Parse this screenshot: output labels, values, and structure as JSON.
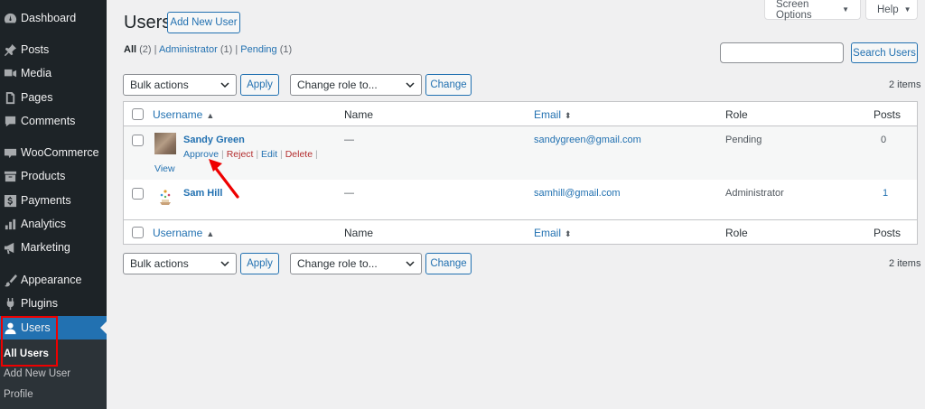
{
  "sidebar": {
    "items": [
      {
        "label": "Dashboard",
        "icon": "dashboard-icon"
      },
      {
        "label": "Posts",
        "icon": "pin-icon"
      },
      {
        "label": "Media",
        "icon": "media-icon"
      },
      {
        "label": "Pages",
        "icon": "pages-icon"
      },
      {
        "label": "Comments",
        "icon": "comment-icon"
      },
      {
        "label": "WooCommerce",
        "icon": "woo-icon"
      },
      {
        "label": "Products",
        "icon": "archive-icon"
      },
      {
        "label": "Payments",
        "icon": "dollar-icon"
      },
      {
        "label": "Analytics",
        "icon": "chart-icon"
      },
      {
        "label": "Marketing",
        "icon": "megaphone-icon"
      },
      {
        "label": "Appearance",
        "icon": "brush-icon"
      },
      {
        "label": "Plugins",
        "icon": "plug-icon"
      },
      {
        "label": "Users",
        "icon": "user-icon"
      }
    ],
    "submenu": [
      "All Users",
      "Add New User",
      "Profile"
    ]
  },
  "header": {
    "title": "Users",
    "add_new": "Add New User",
    "screen_options": "Screen Options",
    "help": "Help"
  },
  "filters": {
    "all": "All",
    "all_count": "(2)",
    "administrator": "Administrator",
    "administrator_count": "(1)",
    "pending": "Pending",
    "pending_count": "(1)",
    "sep": "|"
  },
  "search": {
    "button": "Search Users",
    "value": ""
  },
  "bulk": {
    "actions": "Bulk actions",
    "apply": "Apply",
    "role": "Change role to...",
    "change": "Change",
    "items": "2 items"
  },
  "table": {
    "columns": [
      "Username",
      "Name",
      "Email",
      "Role",
      "Posts"
    ],
    "rows": [
      {
        "username": "Sandy Green",
        "name": "—",
        "email": "sandygreen@gmail.com",
        "role": "Pending",
        "posts": "0",
        "actions": {
          "approve": "Approve",
          "reject": "Reject",
          "edit": "Edit",
          "delete": "Delete",
          "view": "View",
          "sep": "|"
        }
      },
      {
        "username": "Sam Hill",
        "name": "—",
        "email": "samhill@gmail.com",
        "role": "Administrator",
        "posts": "1"
      }
    ]
  },
  "colors": {
    "accent": "#2271b1",
    "sidebar": "#1d2327",
    "highlight": "#e00000"
  }
}
